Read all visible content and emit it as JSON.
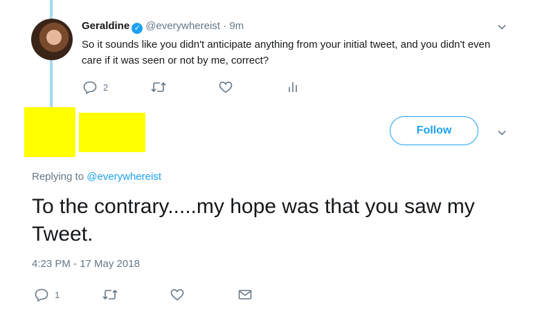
{
  "parent_tweet": {
    "display_name": "Geraldine",
    "verified_glyph": "✓",
    "handle": "@everywhereist",
    "separator": "·",
    "time_ago": "9m",
    "text": "So it sounds like you didn't anticipate anything from your initial tweet, and you didn't even care if it was seen or not by me, correct?",
    "actions": {
      "reply_count": "2"
    }
  },
  "main_tweet": {
    "follow_label": "Follow",
    "replying_prefix": "Replying to",
    "replying_handle": "@everywhereist",
    "text": "To the contrary.....my hope was that you saw my Tweet.",
    "timestamp": "4:23 PM - 17 May 2018",
    "actions": {
      "reply_count": "1"
    }
  },
  "icons": {
    "reply": "reply-icon",
    "retweet": "retweet-icon",
    "like": "heart-icon",
    "analytics": "analytics-icon",
    "dm": "envelope-icon",
    "caret": "chevron-down-icon"
  },
  "colors": {
    "accent": "#1da1f2",
    "muted": "#657786",
    "thread": "#a5d8f0",
    "redaction": "#ffff00"
  }
}
